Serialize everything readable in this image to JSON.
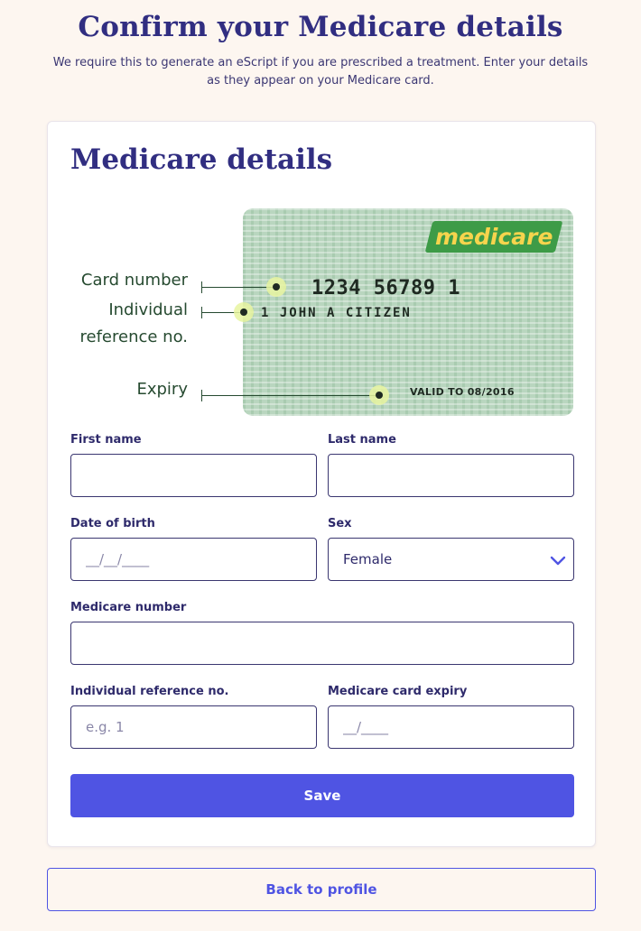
{
  "header": {
    "title": "Confirm your Medicare details",
    "intro": "We require this to generate an eScript if you are prescribed a treatment. Enter your details as they appear on your Medicare card."
  },
  "card": {
    "title": "Medicare details"
  },
  "illustration": {
    "logo_text": "medicare",
    "card_number": "1234 56789 1",
    "card_name": "1 JOHN A CITIZEN",
    "valid_text": "VALID TO 08/2016",
    "label_card_number": "Card number",
    "label_irn_line1": "Individual",
    "label_irn_line2": "reference no.",
    "label_expiry": "Expiry"
  },
  "form": {
    "first_name": {
      "label": "First name",
      "value": "",
      "placeholder": ""
    },
    "last_name": {
      "label": "Last name",
      "value": "",
      "placeholder": ""
    },
    "dob": {
      "label": "Date of birth",
      "value": "",
      "placeholder": "__/__/____"
    },
    "sex": {
      "label": "Sex",
      "selected": "Female"
    },
    "medicare_number": {
      "label": "Medicare number",
      "value": "",
      "placeholder": ""
    },
    "irn": {
      "label": "Individual reference no.",
      "value": "",
      "placeholder": "e.g. 1"
    },
    "expiry": {
      "label": "Medicare card expiry",
      "value": "",
      "placeholder": "__/____"
    },
    "save_label": "Save"
  },
  "footer": {
    "back_label": "Back to profile"
  },
  "colors": {
    "background": "#fdf6f0",
    "primary": "#4f54e3",
    "heading": "#312e81",
    "medicare_green": "#3d9b47",
    "medicare_yellow": "#f6d44d"
  },
  "icons": {
    "select_chevron": "chevron-down-icon"
  }
}
